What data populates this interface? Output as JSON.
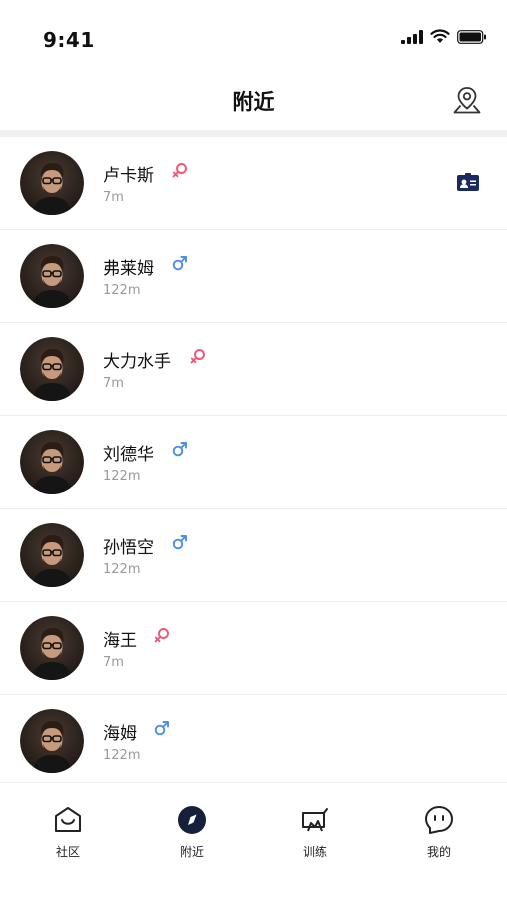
{
  "status_bar": {
    "time": "9:41"
  },
  "nav": {
    "title": "附近"
  },
  "users": [
    {
      "name": "卢卡斯",
      "gender": "female",
      "distance": "7m",
      "has_card": true
    },
    {
      "name": "弗莱姆",
      "gender": "male",
      "distance": "122m",
      "has_card": false
    },
    {
      "name": "大力水手",
      "gender": "female",
      "distance": "7m",
      "has_card": false
    },
    {
      "name": "刘德华",
      "gender": "male",
      "distance": "122m",
      "has_card": false
    },
    {
      "name": "孙悟空",
      "gender": "male",
      "distance": "122m",
      "has_card": false
    },
    {
      "name": "海王",
      "gender": "female",
      "distance": "7m",
      "has_card": false
    },
    {
      "name": "海姆",
      "gender": "male",
      "distance": "122m",
      "has_card": false
    }
  ],
  "tabs": [
    {
      "label": "社区",
      "icon": "home-smile-icon",
      "active": false
    },
    {
      "label": "附近",
      "icon": "compass-icon",
      "active": true
    },
    {
      "label": "训练",
      "icon": "training-icon",
      "active": false
    },
    {
      "label": "我的",
      "icon": "face-icon",
      "active": false
    }
  ],
  "colors": {
    "female": "#f0557a",
    "male": "#4a90e2",
    "active_tab": "#15213a",
    "card": "#1b2a5e"
  }
}
